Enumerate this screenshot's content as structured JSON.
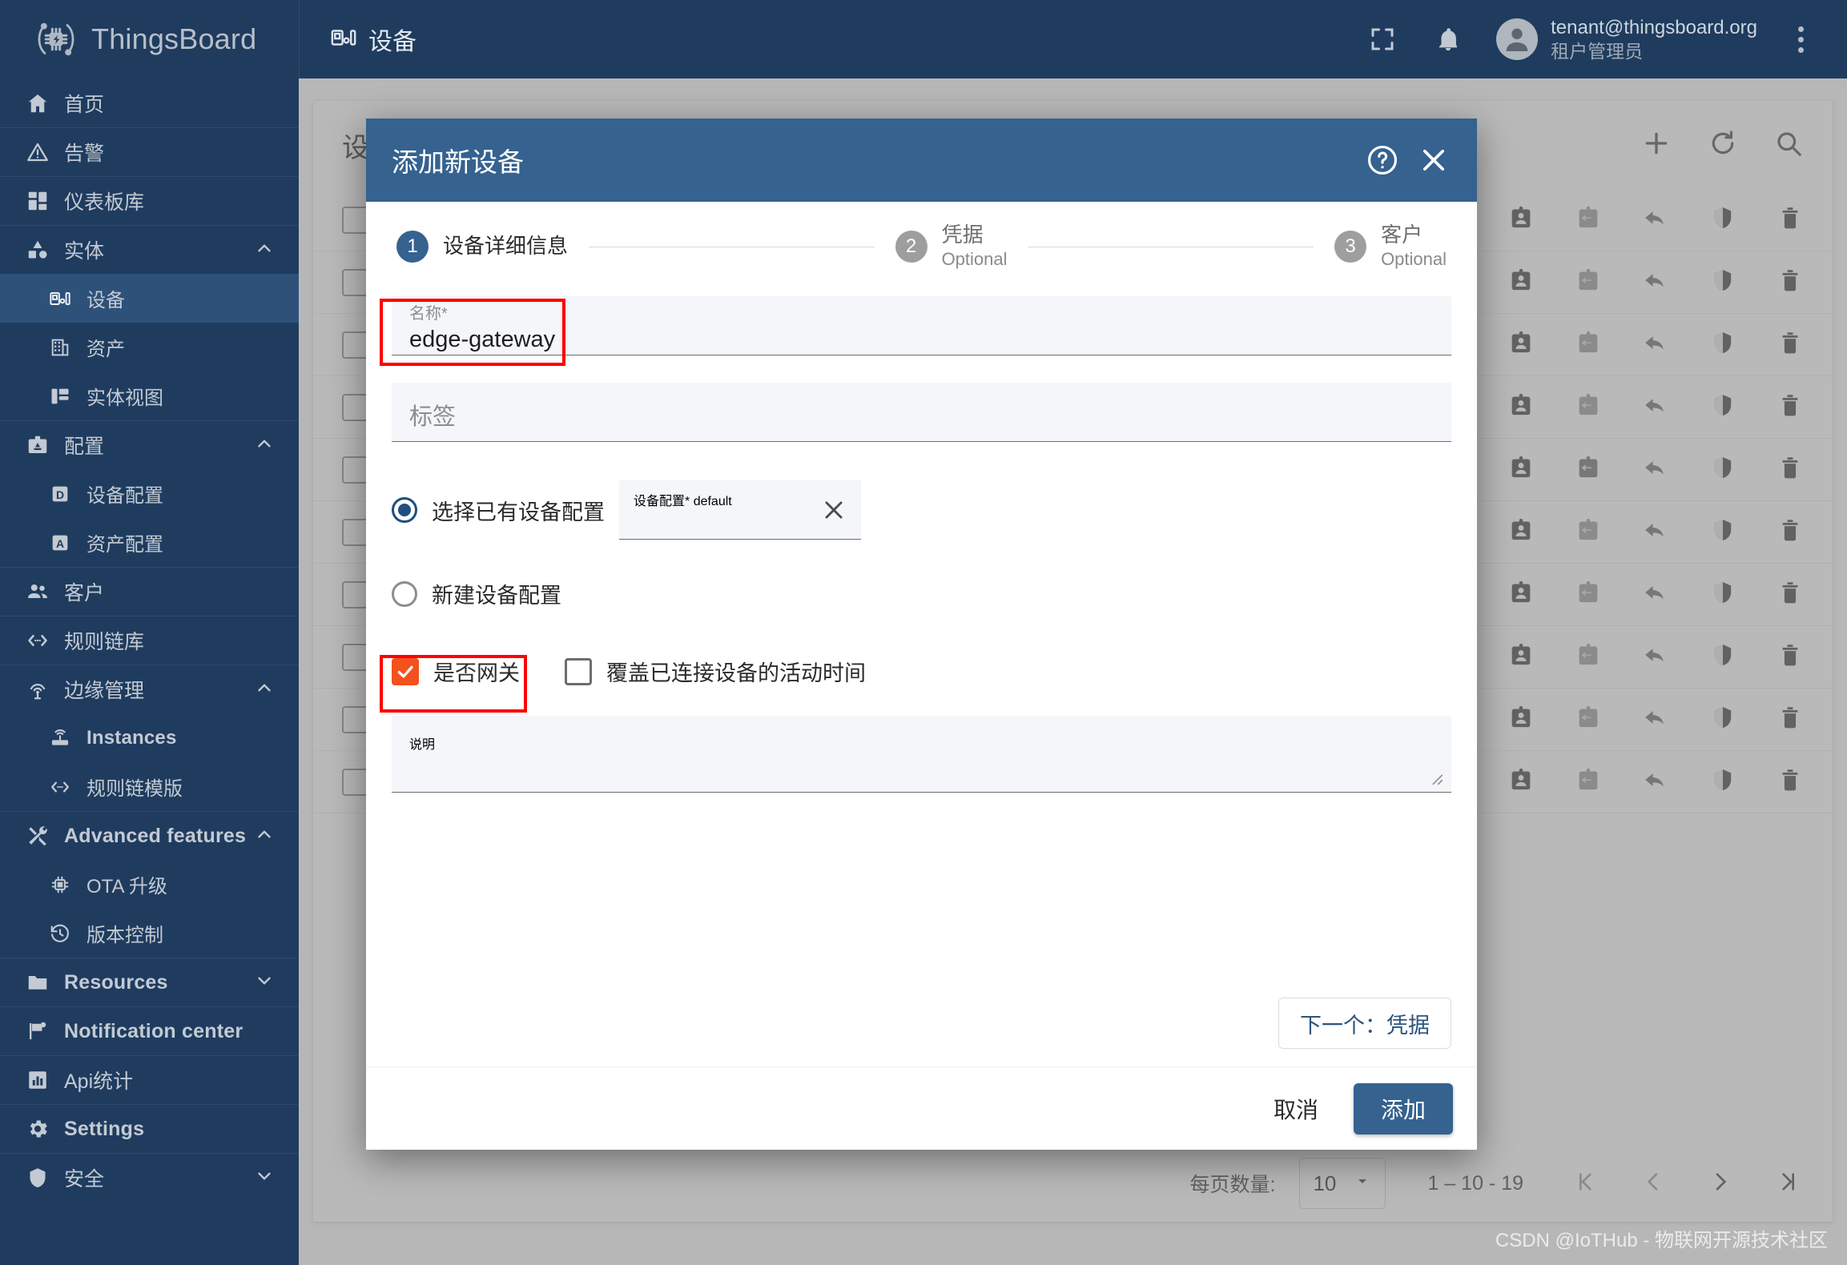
{
  "brand": {
    "name": "ThingsBoard",
    "logo_icon": "thingsboard-chip-icon"
  },
  "topbar": {
    "page_label": "设备",
    "page_icon": "device-icon",
    "fullscreen_icon": "fullscreen-icon",
    "bell_icon": "notifications-bell-icon",
    "avatar_icon": "user-avatar-icon",
    "user_email": "tenant@thingsboard.org",
    "user_role": "租户管理员",
    "kebab_icon": "more-vert-icon"
  },
  "sidebar": {
    "items": [
      {
        "label": "首页",
        "icon": "home-icon",
        "level": "top",
        "group_top": false,
        "active": false,
        "expandable": false,
        "latin": false
      },
      {
        "label": "告警",
        "icon": "alarm-warning-icon",
        "level": "top",
        "group_top": true,
        "active": false,
        "expandable": false,
        "latin": false
      },
      {
        "label": "仪表板库",
        "icon": "dashboards-icon",
        "level": "top",
        "group_top": true,
        "active": false,
        "expandable": false,
        "latin": false
      },
      {
        "label": "实体",
        "icon": "entities-icon",
        "level": "top",
        "group_top": true,
        "active": false,
        "expandable": true,
        "expanded": true,
        "latin": false
      },
      {
        "label": "设备",
        "icon": "device-icon",
        "level": "sub",
        "group_top": false,
        "active": true,
        "expandable": false,
        "latin": false
      },
      {
        "label": "资产",
        "icon": "asset-icon",
        "level": "sub",
        "group_top": false,
        "active": false,
        "expandable": false,
        "latin": false
      },
      {
        "label": "实体视图",
        "icon": "entity-view-icon",
        "level": "sub",
        "group_top": false,
        "active": false,
        "expandable": false,
        "latin": false
      },
      {
        "label": "配置",
        "icon": "profiles-icon",
        "level": "top",
        "group_top": true,
        "active": false,
        "expandable": true,
        "expanded": true,
        "latin": false
      },
      {
        "label": "设备配置",
        "icon": "device-profile-icon",
        "level": "sub",
        "group_top": false,
        "active": false,
        "expandable": false,
        "latin": false
      },
      {
        "label": "资产配置",
        "icon": "asset-profile-icon",
        "level": "sub",
        "group_top": false,
        "active": false,
        "expandable": false,
        "latin": false
      },
      {
        "label": "客户",
        "icon": "customers-icon",
        "level": "top",
        "group_top": true,
        "active": false,
        "expandable": false,
        "latin": false
      },
      {
        "label": "规则链库",
        "icon": "rule-chain-icon",
        "level": "top",
        "group_top": true,
        "active": false,
        "expandable": false,
        "latin": false
      },
      {
        "label": "边缘管理",
        "icon": "edge-icon",
        "level": "top",
        "group_top": true,
        "active": false,
        "expandable": true,
        "expanded": true,
        "latin": false
      },
      {
        "label": "Instances",
        "icon": "router-icon",
        "level": "sub",
        "group_top": false,
        "active": false,
        "expandable": false,
        "latin": true
      },
      {
        "label": "规则链模版",
        "icon": "rule-chain-icon",
        "level": "sub",
        "group_top": false,
        "active": false,
        "expandable": false,
        "latin": false
      },
      {
        "label": "Advanced features",
        "icon": "tools-icon",
        "level": "top",
        "group_top": true,
        "active": false,
        "expandable": true,
        "expanded": true,
        "latin": true
      },
      {
        "label": "OTA 升级",
        "icon": "ota-chip-icon",
        "level": "sub",
        "group_top": false,
        "active": false,
        "expandable": false,
        "latin": false
      },
      {
        "label": "版本控制",
        "icon": "history-icon",
        "level": "sub",
        "group_top": false,
        "active": false,
        "expandable": false,
        "latin": false
      },
      {
        "label": "Resources",
        "icon": "folder-icon",
        "level": "top",
        "group_top": true,
        "active": false,
        "expandable": true,
        "expanded": false,
        "latin": true
      },
      {
        "label": "Notification center",
        "icon": "flag-icon",
        "level": "top",
        "group_top": true,
        "active": false,
        "expandable": false,
        "latin": true
      },
      {
        "label": "Api统计",
        "icon": "bar-chart-icon",
        "level": "top",
        "group_top": true,
        "active": false,
        "expandable": false,
        "latin": false
      },
      {
        "label": "Settings",
        "icon": "gear-icon",
        "level": "top",
        "group_top": true,
        "active": false,
        "expandable": false,
        "latin": true
      },
      {
        "label": "安全",
        "icon": "shield-icon",
        "level": "top",
        "group_top": true,
        "active": false,
        "expandable": true,
        "expanded": false,
        "latin": false
      }
    ]
  },
  "background_page": {
    "title": "设备",
    "toolbar": [
      {
        "icon": "plus-icon",
        "name": "add-device-button"
      },
      {
        "icon": "refresh-icon",
        "name": "refresh-button"
      },
      {
        "icon": "search-icon",
        "name": "search-button"
      }
    ],
    "row_action_icons": [
      "share-icon",
      "assign-to-customer-icon",
      "manage-credentials-icon",
      "unassign-icon",
      "shield-icon",
      "delete-icon"
    ],
    "row_count": 10,
    "paginator": {
      "items_per_page_label": "每页数量:",
      "page_size": "10",
      "range": "1 – 10 - 19",
      "first_icon": "first-page-icon",
      "prev_icon": "previous-page-icon",
      "next_icon": "next-page-icon",
      "last_icon": "last-page-icon"
    }
  },
  "dialog": {
    "title": "添加新设备",
    "help_icon": "help-icon",
    "close_icon": "close-icon",
    "steps": [
      {
        "num": "1",
        "label": "设备详细信息",
        "sub": "",
        "active": true
      },
      {
        "num": "2",
        "label": "凭据",
        "sub": "Optional",
        "active": false
      },
      {
        "num": "3",
        "label": "客户",
        "sub": "Optional",
        "active": false
      }
    ],
    "name_field": {
      "label": "名称*",
      "value": "edge-gateway"
    },
    "label_field": {
      "placeholder": "标签",
      "value": ""
    },
    "profile_mode": {
      "existing_label": "选择已有设备配置",
      "existing_selected": true,
      "new_label": "新建设备配置",
      "new_selected": false
    },
    "profile_field": {
      "label": "设备配置*",
      "value": "default",
      "clear_icon": "close-icon"
    },
    "gateway_checkbox": {
      "label": "是否网关",
      "checked": true,
      "color": "#f4511e"
    },
    "overwrite_checkbox": {
      "label": "覆盖已连接设备的活动时间",
      "checked": false
    },
    "description_field": {
      "placeholder": "说明",
      "value": ""
    },
    "next_button": "下一个：凭据",
    "cancel_button": "取消",
    "add_button": "添加"
  },
  "annotations": {
    "highlight_color": "#ff0000",
    "boxes": [
      "name-field-highlight",
      "gateway-checkbox-highlight"
    ]
  },
  "watermark": "CSDN @IoTHub - 物联网开源技术社区"
}
